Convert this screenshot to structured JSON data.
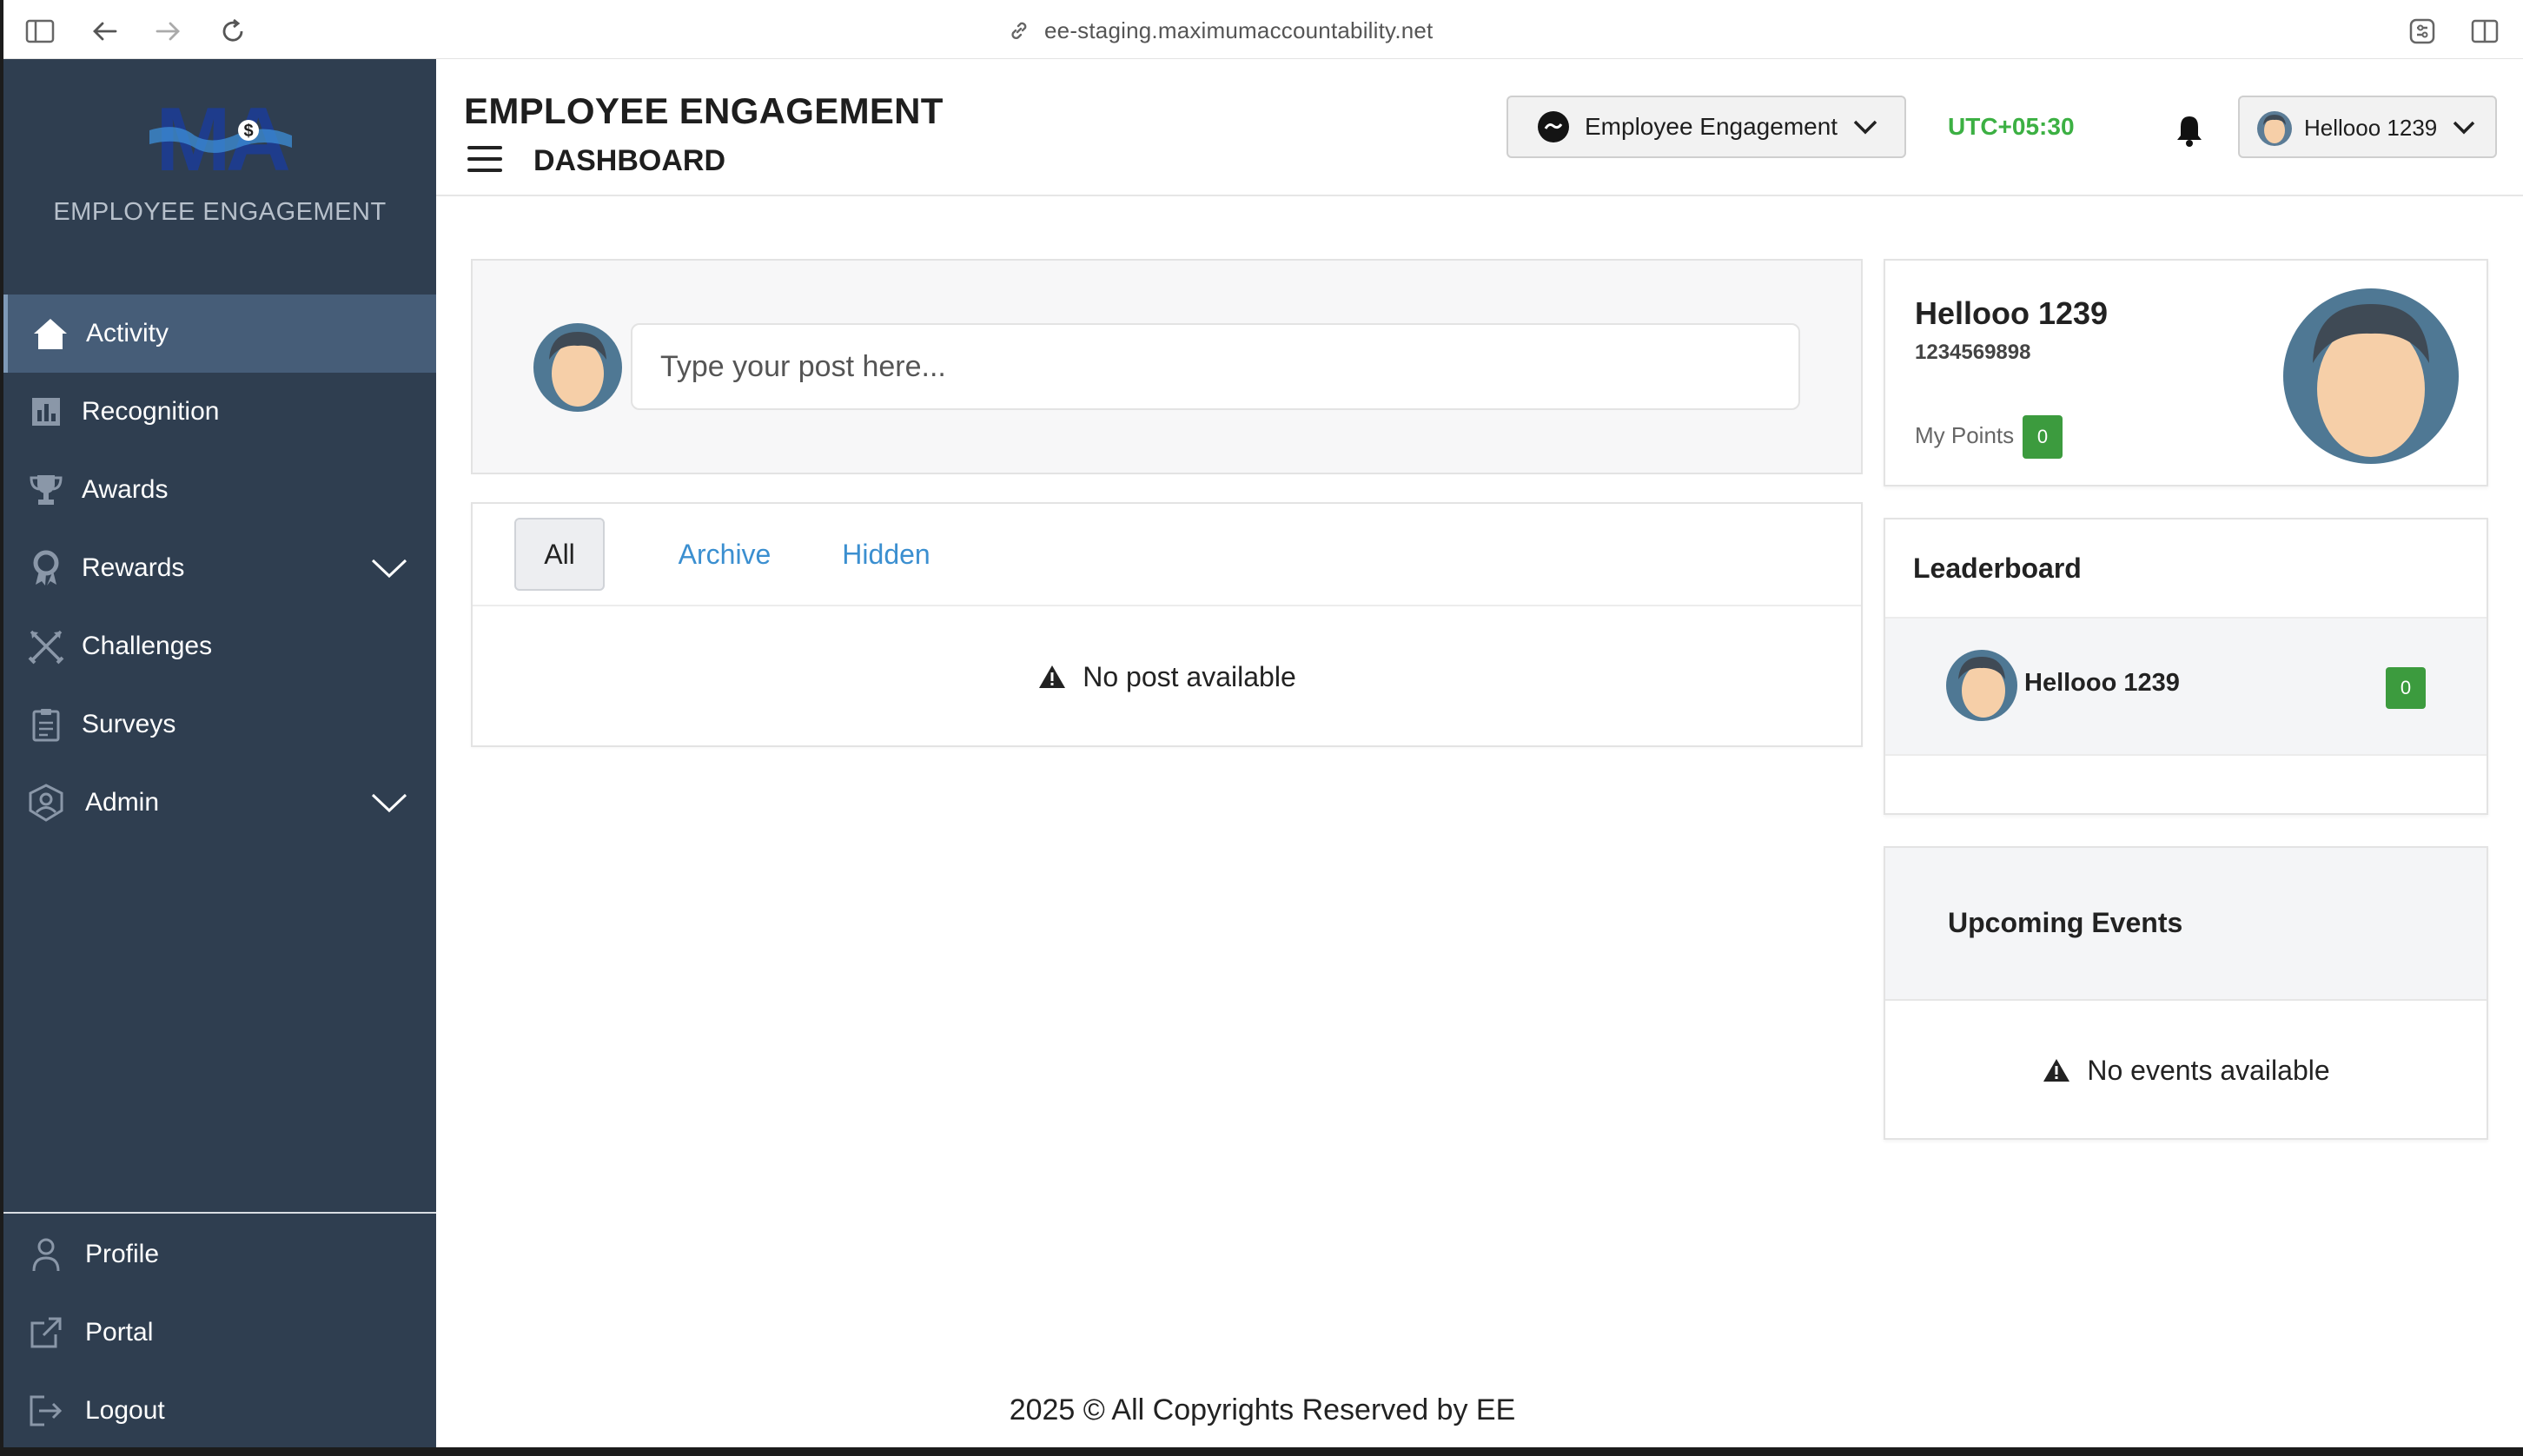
{
  "browser": {
    "url": "ee-staging.maximumaccountability.net"
  },
  "sidebar": {
    "logo_text": "MA",
    "brand_subtitle": "EMPLOYEE ENGAGEMENT",
    "items": [
      {
        "label": "Activity",
        "icon": "home-icon",
        "active": true
      },
      {
        "label": "Recognition",
        "icon": "chart-icon"
      },
      {
        "label": "Awards",
        "icon": "trophy-icon"
      },
      {
        "label": "Rewards",
        "icon": "medal-icon",
        "expandable": true
      },
      {
        "label": "Challenges",
        "icon": "arrows-cross-icon"
      },
      {
        "label": "Surveys",
        "icon": "clipboard-icon"
      },
      {
        "label": "Admin",
        "icon": "user-shield-icon",
        "expandable": true
      }
    ],
    "bottom_items": [
      {
        "label": "Profile",
        "icon": "user-icon"
      },
      {
        "label": "Portal",
        "icon": "external-link-icon"
      },
      {
        "label": "Logout",
        "icon": "logout-icon"
      }
    ]
  },
  "header": {
    "app_title": "EMPLOYEE ENGAGEMENT",
    "page_title": "DASHBOARD",
    "workspace_label": "Employee Engagement",
    "timezone": "UTC+05:30",
    "user_name": "Hellooo 1239"
  },
  "post": {
    "placeholder": "Type your post here..."
  },
  "feed": {
    "tabs": [
      "All",
      "Archive",
      "Hidden"
    ],
    "active_tab": "All",
    "empty_message": "No post available"
  },
  "profile_card": {
    "name": "Hellooo 1239",
    "phone": "1234569898",
    "points_label": "My Points",
    "points": "0"
  },
  "leaderboard": {
    "title": "Leaderboard",
    "entries": [
      {
        "name": "Hellooo 1239",
        "points": "0"
      }
    ]
  },
  "events": {
    "title": "Upcoming Events",
    "empty_message": "No events available"
  },
  "footer": {
    "text": "2025 © All Copyrights Reserved by EE"
  },
  "colors": {
    "sidebar_bg": "#2f3e50",
    "sidebar_active": "#465d78",
    "accent_green": "#3cb043",
    "points_badge": "#3c9b3e",
    "link_blue": "#3b8fd0"
  }
}
